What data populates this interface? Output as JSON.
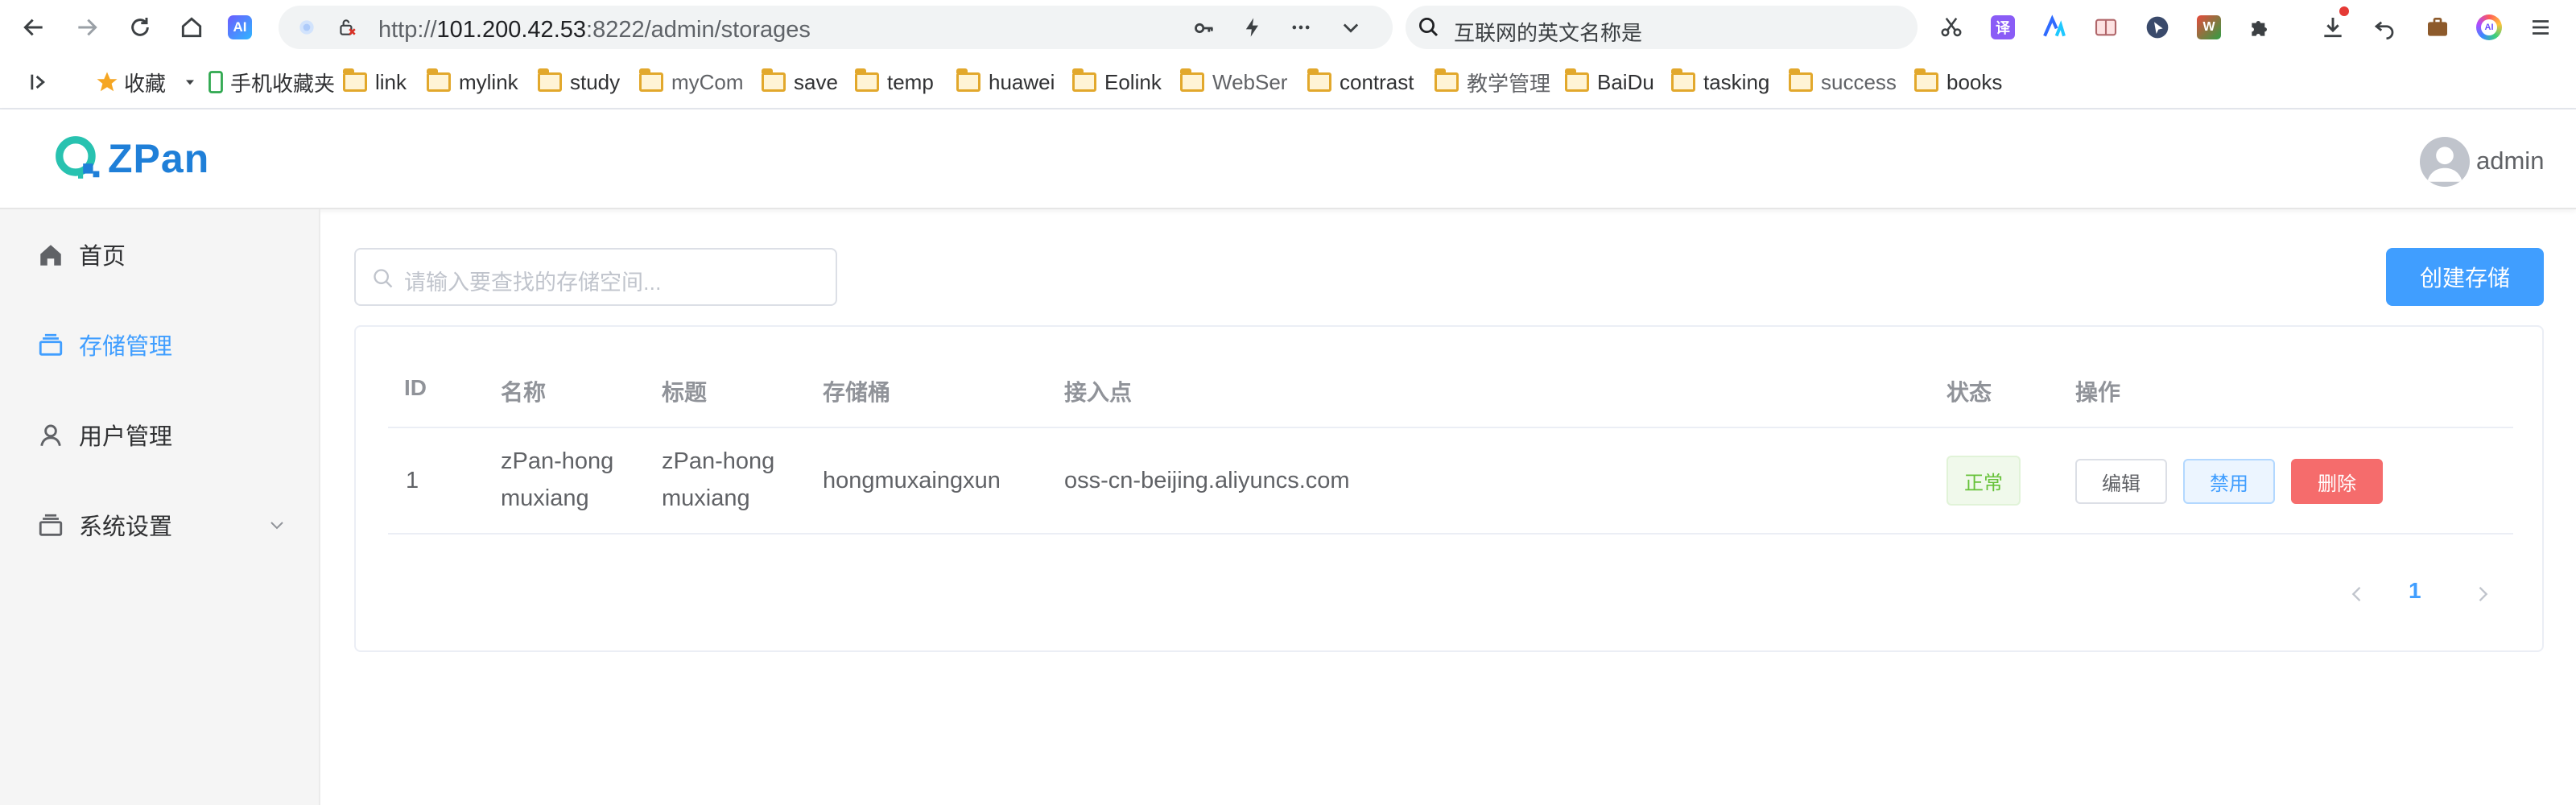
{
  "browser": {
    "url_prefix": "http://",
    "url_host": "101.200.42.53",
    "url_rest": ":8222/admin/storages",
    "search_text": "互联网的英文名称是"
  },
  "bookmarks": {
    "items": [
      {
        "label": "收藏",
        "icon": "star-icon"
      },
      {
        "label": "手机收藏夹",
        "icon": "phone-icon"
      },
      {
        "label": "link",
        "icon": "folder-icon"
      },
      {
        "label": "mylink",
        "icon": "folder-icon"
      },
      {
        "label": "study",
        "icon": "folder-icon"
      },
      {
        "label": "myCom",
        "icon": "folder-icon"
      },
      {
        "label": "save",
        "icon": "folder-icon"
      },
      {
        "label": "temp",
        "icon": "folder-icon"
      },
      {
        "label": "huawei",
        "icon": "folder-icon"
      },
      {
        "label": "Eolink",
        "icon": "folder-icon"
      },
      {
        "label": "WebSer",
        "icon": "folder-icon"
      },
      {
        "label": "contrast",
        "icon": "folder-icon"
      },
      {
        "label": "教学管理",
        "icon": "folder-icon"
      },
      {
        "label": "BaiDu",
        "icon": "folder-icon"
      },
      {
        "label": "tasking",
        "icon": "folder-icon"
      },
      {
        "label": "success",
        "icon": "folder-icon"
      },
      {
        "label": "books",
        "icon": "folder-icon"
      }
    ]
  },
  "header": {
    "logo_text": "ZPan",
    "user_name": "admin"
  },
  "sidebar": {
    "items": [
      {
        "label": "首页",
        "icon": "home-icon",
        "active": false
      },
      {
        "label": "存储管理",
        "icon": "storage-icon",
        "active": true
      },
      {
        "label": "用户管理",
        "icon": "user-icon",
        "active": false
      },
      {
        "label": "系统设置",
        "icon": "settings-icon",
        "active": false
      }
    ]
  },
  "main": {
    "search_placeholder": "请输入要查找的存储空间...",
    "create_button": "创建存储",
    "table": {
      "headers": {
        "id": "ID",
        "name": "名称",
        "title": "标题",
        "bucket": "存储桶",
        "endpoint": "接入点",
        "status": "状态",
        "actions": "操作"
      },
      "rows": [
        {
          "id": "1",
          "name_line1": "zPan-hong",
          "name_line2": "muxiang",
          "title_line1": "zPan-hong",
          "title_line2": "muxiang",
          "bucket": "hongmuxaingxun",
          "endpoint": "oss-cn-beijing.aliyuncs.com",
          "status": "正常",
          "edit": "编辑",
          "disable": "禁用",
          "delete": "删除"
        }
      ]
    },
    "pagination": {
      "current_page": "1"
    }
  },
  "colors": {
    "accent": "#409eff",
    "success": "#67c23a",
    "danger": "#f56c6c"
  }
}
